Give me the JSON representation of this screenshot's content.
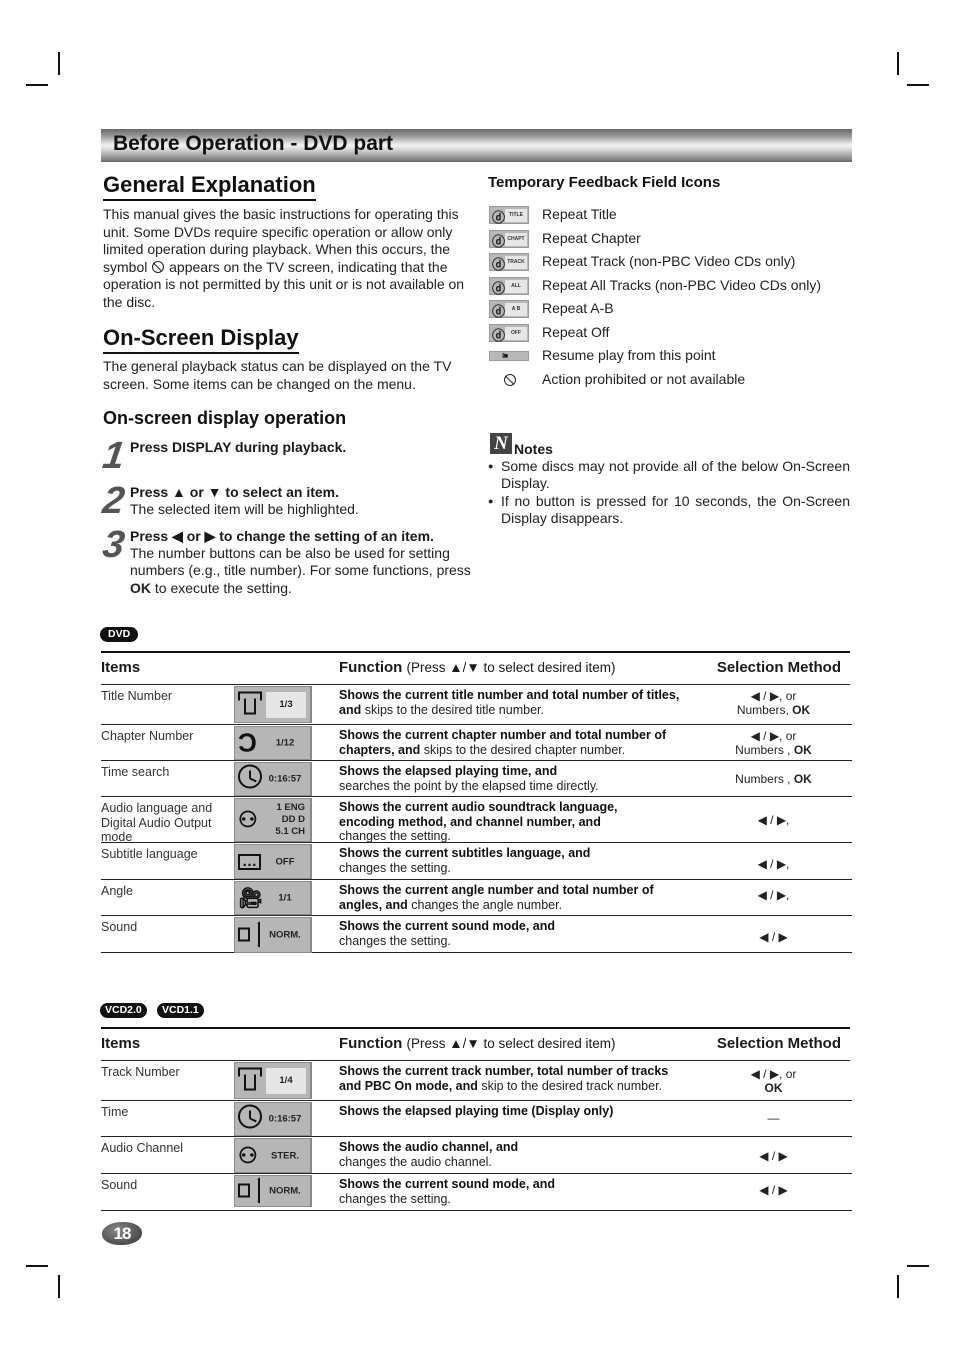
{
  "banner": {
    "title": "Before Operation - DVD part"
  },
  "general": {
    "heading": "General Explanation",
    "text_before_symbol": "This manual gives the basic instructions for operating this unit. Some DVDs require specific operation or allow only limited operation during playback. When this occurs, the symbol",
    "symbol_icon": "prohibited-icon",
    "text_after_symbol": "appears on the TV screen, indicating that the operation is not permitted by this unit or is not available on the disc."
  },
  "osd": {
    "heading": "On-Screen Display",
    "text": "The general playback status can be displayed on the TV screen. Some items can be changed on the menu.",
    "operation_heading": "On-screen display operation",
    "steps": [
      {
        "num": "1",
        "bold": "Press DISPLAY during playback.",
        "text": ""
      },
      {
        "num": "2",
        "bold": "Press ▲ or ▼ to select an item.",
        "text": "The selected item will be highlighted."
      },
      {
        "num": "3",
        "bold": "Press ◀ or ▶ to change the setting of an item.",
        "text_a": "The number buttons can be also be used for setting numbers (e.g., title number). For some functions, press ",
        "text_ok": "OK",
        "text_b": " to execute the setting."
      }
    ]
  },
  "feedback": {
    "heading": "Temporary Feedback Field Icons",
    "items": [
      {
        "icon": "repeat-title-icon",
        "icon_label": "TITLE",
        "label": "Repeat Title"
      },
      {
        "icon": "repeat-chapter-icon",
        "icon_label": "CHAPT",
        "label": "Repeat Chapter"
      },
      {
        "icon": "repeat-track-icon",
        "icon_label": "TRACK",
        "label": "Repeat Track (non-PBC Video CDs only)"
      },
      {
        "icon": "repeat-all-icon",
        "icon_label": "ALL",
        "label": "Repeat All Tracks (non-PBC Video CDs only)"
      },
      {
        "icon": "repeat-ab-icon",
        "icon_label": "A  B",
        "label": "Repeat A-B"
      },
      {
        "icon": "repeat-off-icon",
        "icon_label": "OFF",
        "label": "Repeat Off"
      },
      {
        "icon": "resume-icon",
        "icon_label": "II■",
        "label": "Resume play from this point"
      },
      {
        "icon": "prohibited-icon",
        "icon_label": "",
        "label": "Action prohibited or not available"
      }
    ]
  },
  "notes": {
    "icon": "notes-icon",
    "icon_glyph": "N",
    "title": "Notes",
    "items": [
      "Some discs may not provide all of the below On-Screen Display.",
      "If no button is pressed for 10 seconds, the On-Screen Display disappears."
    ]
  },
  "dvd_table": {
    "badge": "DVD",
    "headers": {
      "items": "Items",
      "function": "Function",
      "function_hint": "(Press ▲/▼ to select desired item)",
      "selection": "Selection Method"
    },
    "rows": [
      {
        "item": "Title Number",
        "icon": "title-icon",
        "value": "1/3",
        "fn_bold": "Shows the current title number and total number of titles, and",
        "fn_text": " skips to the desired title number.",
        "sel_line1": "◀ / ▶, or",
        "sel_line2a": "Numbers, ",
        "sel_line2b": "OK"
      },
      {
        "item": "Chapter Number",
        "icon": "chapter-icon",
        "value": "1/12",
        "fn_bold": "Shows the current chapter number and total number of chapters, and",
        "fn_text": " skips to the desired chapter number.",
        "sel_line1": "◀ / ▶, or",
        "sel_line2a": "Numbers , ",
        "sel_line2b": "OK"
      },
      {
        "item": "Time search",
        "icon": "clock-icon",
        "value": "0:16:57",
        "fn_bold": "Shows the elapsed playing time, and",
        "fn_text": "searches the point by the elapsed time directly.",
        "sel_line1": "",
        "sel_line2a": "Numbers , ",
        "sel_line2b": "OK"
      },
      {
        "item": "Audio language and Digital Audio Output mode",
        "icon": "audio-speaker-head-icon",
        "value_lines": [
          "1   ENG",
          "DD D",
          "5.1  CH"
        ],
        "fn_bold": "Shows the current audio soundtrack language, encoding method, and channel number, and",
        "fn_text": "changes the setting.",
        "sel_line1": "◀ / ▶,",
        "sel_line2a": "",
        "sel_line2b": ""
      },
      {
        "item": "Subtitle language",
        "icon": "subtitle-icon",
        "value": "OFF",
        "fn_bold": "Shows the current subtitles language, and",
        "fn_text": "changes the setting.",
        "sel_line1": "◀ / ▶,",
        "sel_line2a": "",
        "sel_line2b": ""
      },
      {
        "item": "Angle",
        "icon": "camera-angle-icon",
        "value": "1/1",
        "fn_bold": "Shows the current angle number and total number of angles, and",
        "fn_text": " changes the angle number.",
        "sel_line1": "◀ / ▶,",
        "sel_line2a": "",
        "sel_line2b": ""
      },
      {
        "item": "Sound",
        "icon": "speaker-icon",
        "value": "NORM.",
        "fn_bold": "Shows the current sound mode, and",
        "fn_text": "changes the setting.",
        "sel_line1": "◀ / ▶",
        "sel_line2a": "",
        "sel_line2b": ""
      }
    ]
  },
  "vcd_table": {
    "badges": [
      "VCD2.0",
      "VCD1.1"
    ],
    "headers": {
      "items": "Items",
      "function": "Function",
      "function_hint": "(Press ▲/▼ to select desired item)",
      "selection": "Selection Method"
    },
    "rows": [
      {
        "item": "Track Number",
        "icon": "title-icon",
        "value": "1/4",
        "fn_bold": "Shows the current track number, total number of tracks and PBC On mode, and",
        "fn_text": " skip to the desired track number.",
        "sel_line1": "◀ / ▶, or",
        "sel_line2a": "",
        "sel_line2b": "OK"
      },
      {
        "item": "Time",
        "icon": "clock-icon",
        "value": "0:16:57",
        "fn_bold": "Shows the elapsed playing time (Display only)",
        "fn_text": "",
        "sel_line1": "—",
        "sel_line2a": "",
        "sel_line2b": ""
      },
      {
        "item": "Audio Channel",
        "icon": "audio-speaker-head-icon",
        "value": "STER.",
        "fn_bold": "Shows the audio channel, and",
        "fn_text": "changes the audio channel.",
        "sel_line1": "◀ / ▶",
        "sel_line2a": "",
        "sel_line2b": ""
      },
      {
        "item": "Sound",
        "icon": "speaker-icon",
        "value": "NORM.",
        "fn_bold": "Shows the current sound mode, and",
        "fn_text": "changes the setting.",
        "sel_line1": "◀ / ▶",
        "sel_line2a": "",
        "sel_line2b": ""
      }
    ]
  },
  "page_number": "18"
}
